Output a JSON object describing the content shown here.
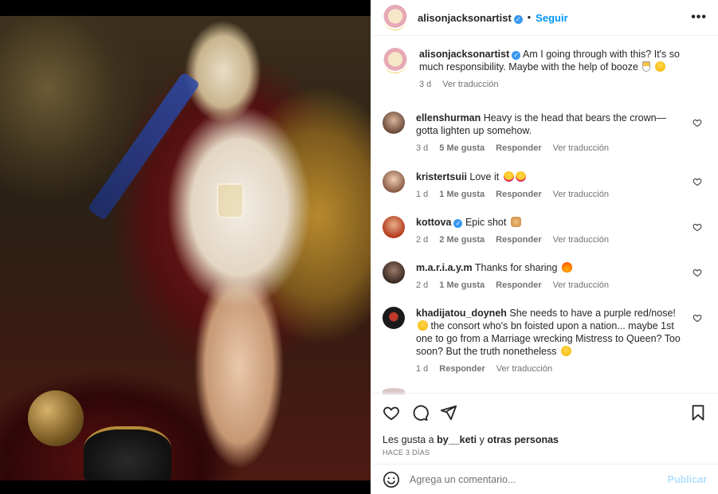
{
  "header": {
    "username": "alisonjacksonartist",
    "dot": "•",
    "follow_label": "Seguir",
    "more_label": "•••"
  },
  "caption": {
    "username": "alisonjacksonartist",
    "text": "Am I going through with this? It's so much responsibility. Maybe with the help of booze",
    "age": "3 d",
    "translate": "Ver traducción"
  },
  "comments": [
    {
      "user": "ellenshurman",
      "text": "Heavy is the head that bears the crown—gotta lighten up somehow.",
      "age": "3 d",
      "likes": "5 Me gusta",
      "reply": "Responder",
      "translate": "Ver traducción"
    },
    {
      "user": "kristertsuii",
      "text": "Love it",
      "age": "1 d",
      "likes": "1 Me gusta",
      "reply": "Responder",
      "translate": "Ver traducción"
    },
    {
      "user": "kottova",
      "text": "Epic shot",
      "age": "2 d",
      "likes": "2 Me gusta",
      "reply": "Responder",
      "translate": "Ver traducción"
    },
    {
      "user": "m.a.r.i.a.y.m",
      "text": "Thanks for sharing",
      "age": "2 d",
      "likes": "1 Me gusta",
      "reply": "Responder",
      "translate": "Ver traducción"
    },
    {
      "user": "khadijatou_doyneh",
      "text": "She needs to have a purple red/nose!",
      "text2": "the consort who's bn foisted upon a nation... maybe 1st one to go from a Marriage wrecking Mistress to Queen? Too soon? But the truth nonetheless",
      "age": "1 d",
      "reply": "Responder",
      "translate": "Ver traducción"
    }
  ],
  "likes": {
    "prefix": "Les gusta a",
    "user": "by__keti",
    "conj": "y",
    "others": "otras personas",
    "ago": "HACE 3 DÍAS"
  },
  "add_comment": {
    "placeholder": "Agrega un comentario...",
    "post_label": "Publicar"
  },
  "colors": {
    "accent": "#0095f6",
    "post_disabled": "#b2dffc",
    "muted": "#737373"
  }
}
